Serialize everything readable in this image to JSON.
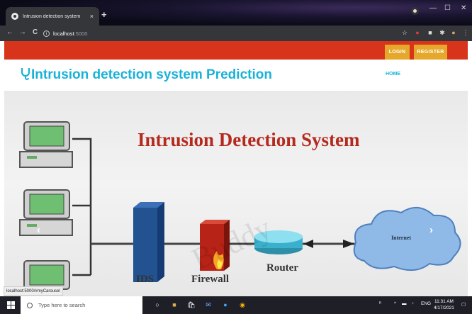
{
  "browser": {
    "tab_title": "Intrusion detection system",
    "tab_close": "×",
    "new_tab": "+",
    "window_controls": [
      "—",
      "☐",
      "✕"
    ],
    "url_host": "localhost",
    "url_port": ":5000",
    "nav_back": "←",
    "nav_forward": "→",
    "nav_reload": "C"
  },
  "site": {
    "login_label": "LOGIN",
    "register_label": "REGISTER",
    "brand_title": "Intrusion detection system Prediction",
    "nav_home": "HOME"
  },
  "slide": {
    "title": "Intrusion Detection System",
    "ids_label": "IDS",
    "firewall_label": "Firewall",
    "router_label": "Router",
    "internet_label": "Internet",
    "watermark": "Buddy",
    "prev": "‹",
    "next": "›"
  },
  "status_url": "localhost:5000/#myCarousel",
  "taskbar": {
    "search_placeholder": "Type here to search",
    "lang": "ENG",
    "time": "11:31 AM",
    "date": "4/17/2021"
  },
  "colors": {
    "accent": "#19b2d8",
    "top_strip": "#d8341c",
    "button": "#e6a82a",
    "title_red": "#b52a1e"
  }
}
